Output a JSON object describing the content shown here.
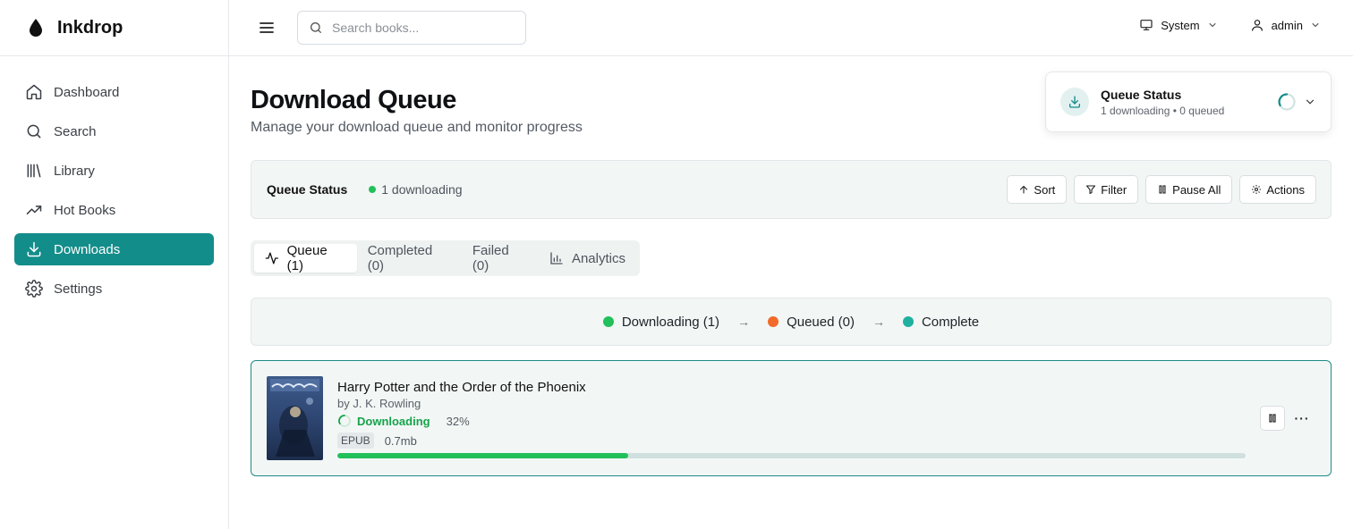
{
  "app": {
    "name": "Inkdrop"
  },
  "sidebar": {
    "items": [
      {
        "label": "Dashboard",
        "icon": "home-icon"
      },
      {
        "label": "Search",
        "icon": "search-icon"
      },
      {
        "label": "Library",
        "icon": "library-icon"
      },
      {
        "label": "Hot Books",
        "icon": "trending-icon"
      },
      {
        "label": "Downloads",
        "icon": "download-icon",
        "active": true
      },
      {
        "label": "Settings",
        "icon": "gear-icon"
      }
    ]
  },
  "topbar": {
    "search_placeholder": "Search books...",
    "theme_label": "System",
    "user_label": "admin"
  },
  "page": {
    "title": "Download Queue",
    "subtitle": "Manage your download queue and monitor progress"
  },
  "queue_card": {
    "title": "Queue Status",
    "meta": "1 downloading • 0 queued"
  },
  "status_bar": {
    "label": "Queue Status",
    "badge": "1 downloading",
    "badge_color": "#22c05a",
    "buttons": {
      "sort": "Sort",
      "filter": "Filter",
      "pause_all": "Pause All",
      "actions": "Actions"
    }
  },
  "tabs": [
    {
      "label": "Queue (1)",
      "icon": "activity-icon",
      "active": true
    },
    {
      "label": "Completed (0)"
    },
    {
      "label": "Failed (0)"
    },
    {
      "label": "Analytics",
      "icon": "bar-chart-icon"
    }
  ],
  "pipeline": {
    "steps": [
      {
        "label": "Downloading (1)",
        "color": "#22c05a"
      },
      {
        "label": "Queued (0)",
        "color": "#f26a2a"
      },
      {
        "label": "Complete",
        "color": "#1fb0a0"
      }
    ],
    "arrow": "→"
  },
  "download_item": {
    "title": "Harry Potter and the Order of the Phoenix",
    "author": "by J. K. Rowling",
    "status": "Downloading",
    "percent_label": "32%",
    "progress": 0.32,
    "format": "EPUB",
    "size": "0.7mb",
    "more_label": "···"
  },
  "colors": {
    "accent": "#138d8a",
    "success": "#22c05a"
  }
}
